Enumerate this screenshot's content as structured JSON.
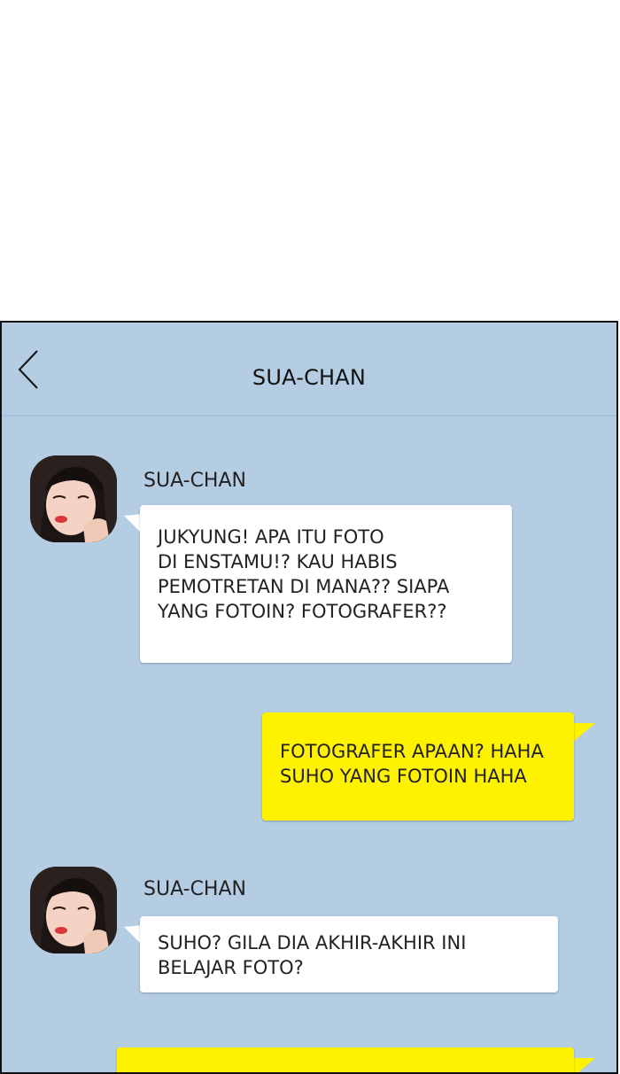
{
  "header": {
    "title": "SUA-CHAN",
    "back_icon": "chevron-left-icon"
  },
  "messages": [
    {
      "direction": "incoming",
      "sender": "SUA-CHAN",
      "lines": [
        "JUKYUNG! APA ITU FOTO",
        "DI ENSTAMU!? KAU HABIS",
        "PEMOTRETAN DI MANA?? SIAPA",
        "YANG FOTOIN? FOTOGRAFER??"
      ]
    },
    {
      "direction": "outgoing",
      "lines": [
        "FOTOGRAFER APAAN? HAHA",
        "SUHO YANG FOTOIN HAHA"
      ]
    },
    {
      "direction": "incoming",
      "sender": "SUA-CHAN",
      "lines": [
        "SUHO? GILA DIA AKHIR-AKHIR INI",
        "BELAJAR FOTO?"
      ]
    },
    {
      "direction": "outgoing",
      "lines": []
    }
  ],
  "colors": {
    "chat_background": "#b4cde3",
    "incoming_bubble": "#ffffff",
    "outgoing_bubble": "#fff200",
    "text": "#222222"
  }
}
